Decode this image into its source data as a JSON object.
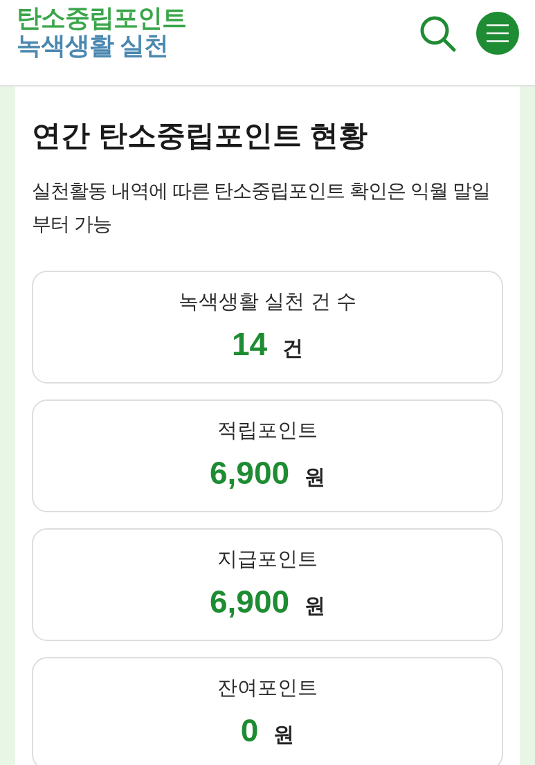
{
  "header": {
    "logo_lines": [
      "탄소중립포인트",
      "녹색생활 실천"
    ]
  },
  "page": {
    "title": "연간 탄소중립포인트 현황",
    "description": "실천활동 내역에 따른 탄소중립포인트 확인은 익월 말일부터 가능"
  },
  "stats": [
    {
      "label": "녹색생활 실천 건 수",
      "value": "14",
      "unit": "건"
    },
    {
      "label": "적립포인트",
      "value": "6,900",
      "unit": "원"
    },
    {
      "label": "지급포인트",
      "value": "6,900",
      "unit": "원"
    },
    {
      "label": "잔여포인트",
      "value": "0",
      "unit": "원"
    }
  ]
}
